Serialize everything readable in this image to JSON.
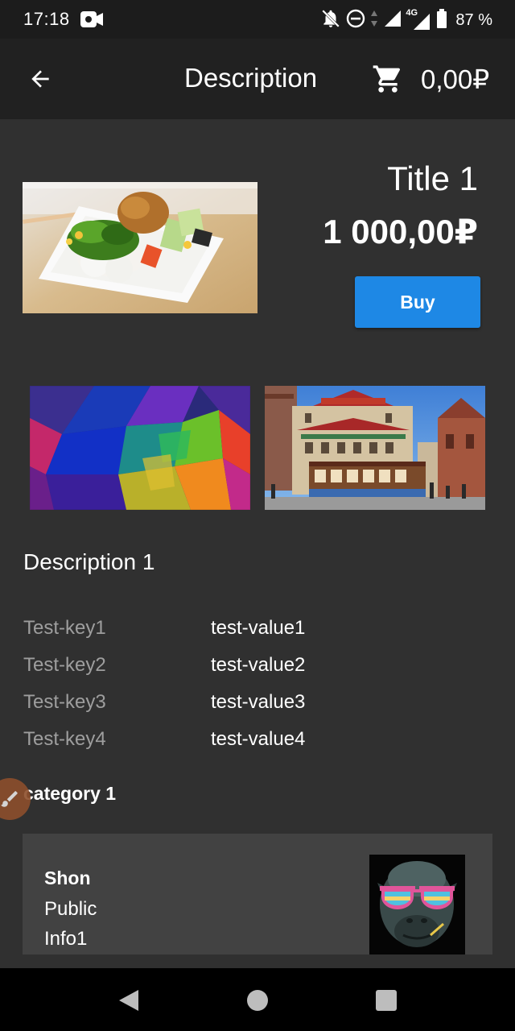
{
  "status_bar": {
    "time": "17:18",
    "network": "4G",
    "battery": "87 %",
    "icons": [
      "video-record-icon",
      "notifications-off-icon",
      "do-not-disturb-icon",
      "data-arrows-icon",
      "signal-icon",
      "signal-4g-icon",
      "battery-icon"
    ]
  },
  "app_bar": {
    "title": "Description",
    "cart_total": "0,00₽",
    "icons": [
      "back-arrow-icon",
      "shopping-cart-icon"
    ]
  },
  "product": {
    "title": "Title 1",
    "price": "1 000,00₽",
    "buy_label": "Buy",
    "description": "Description 1",
    "images": [
      "bento-food-photo",
      "abstract-colorful-polygon-image",
      "chinatown-cable-car-photo"
    ]
  },
  "properties": [
    {
      "key": "Test-key1",
      "value": "test-value1"
    },
    {
      "key": "Test-key2",
      "value": "test-value2"
    },
    {
      "key": "Test-key3",
      "value": "test-value3"
    },
    {
      "key": "Test-key4",
      "value": "test-value4"
    }
  ],
  "category": "category 1",
  "seller": {
    "name": "Shon",
    "type": "Public",
    "info": "Info1",
    "avatar": "gorilla-sunglasses-avatar"
  },
  "colors": {
    "accent": "#1e88e5",
    "background": "#303030",
    "app_bar": "#212121",
    "card": "#424242",
    "key_text": "#9e9e9e"
  },
  "nav_bar": {
    "icons": [
      "back-triangle-icon",
      "home-circle-icon",
      "recents-square-icon"
    ]
  }
}
